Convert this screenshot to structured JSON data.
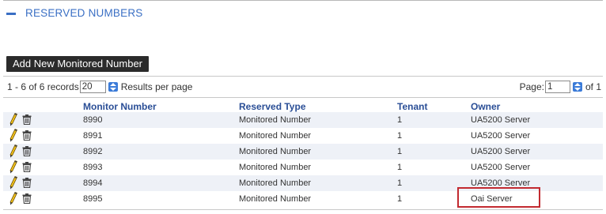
{
  "section": {
    "title": "RESERVED NUMBERS",
    "collapse_icon": "minus-icon"
  },
  "toolbar": {
    "add_button_label": "Add New Monitored Number"
  },
  "pager": {
    "records_text": "1 - 6 of 6 records",
    "results_per_page_value": "20",
    "results_per_page_label": "Results per page",
    "page_label": "Page:",
    "page_value": "1",
    "of_text": "of 1"
  },
  "table": {
    "columns": [
      "Monitor Number",
      "Reserved Type",
      "Tenant",
      "Owner"
    ],
    "rows": [
      {
        "monitor_number": "8990",
        "reserved_type": "Monitored Number",
        "tenant": "1",
        "owner": "UA5200 Server"
      },
      {
        "monitor_number": "8991",
        "reserved_type": "Monitored Number",
        "tenant": "1",
        "owner": "UA5200 Server"
      },
      {
        "monitor_number": "8992",
        "reserved_type": "Monitored Number",
        "tenant": "1",
        "owner": "UA5200 Server"
      },
      {
        "monitor_number": "8993",
        "reserved_type": "Monitored Number",
        "tenant": "1",
        "owner": "UA5200 Server"
      },
      {
        "monitor_number": "8994",
        "reserved_type": "Monitored Number",
        "tenant": "1",
        "owner": "UA5200 Server"
      },
      {
        "monitor_number": "8995",
        "reserved_type": "Monitored Number",
        "tenant": "1",
        "owner": "Oai Server"
      }
    ],
    "row_icons": [
      "pencil-edit-icon",
      "trash-delete-icon"
    ]
  },
  "colors": {
    "accent": "#3a6fc4",
    "header_text": "#2a4e96",
    "button_bg": "#2b2b2b",
    "alt_row": "#eef1f7",
    "highlight": "#c22a30"
  }
}
